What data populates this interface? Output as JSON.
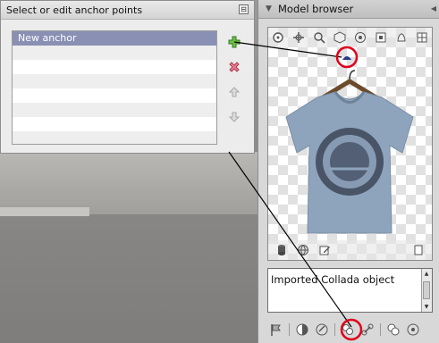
{
  "anchor_dialog": {
    "title": "Select or edit anchor points",
    "close_symbol": "⊟",
    "items": [
      "New anchor",
      "",
      "",
      "",
      "",
      "",
      "",
      ""
    ],
    "selected_index": 0
  },
  "model_browser": {
    "title": "Model browser",
    "info_text": "Imported Collada object"
  },
  "colors": {
    "selection": "#8a90b4",
    "annotation_red": "#e0001b"
  }
}
